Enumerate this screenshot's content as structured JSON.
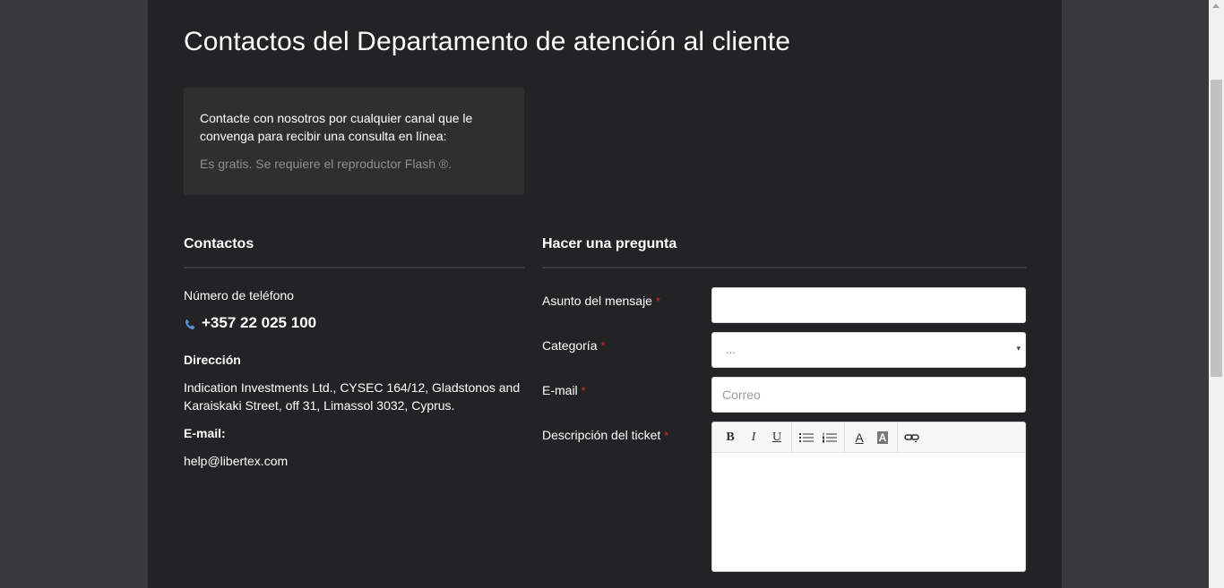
{
  "header": {
    "title": "Contactos del Departamento de atención al cliente"
  },
  "info_box": {
    "text": "Contacte con nosotros por cualquier canal que le convenga para recibir una consulta en línea:",
    "note": "Es gratis. Se requiere el reproductor Flash ®."
  },
  "contacts": {
    "title": "Contactos",
    "phone_label": "Número de teléfono",
    "phone": "+357 22 025 100",
    "address_label": "Dirección",
    "address": "Indication Investments Ltd., CYSEC 164/12, Gladstonos and Karaiskaki Street, off 31, Limassol 3032, Cyprus.",
    "email_label": "E-mail:",
    "email": "help@libertex.com"
  },
  "form": {
    "title": "Hacer una pregunta",
    "required_mark": "*",
    "subject_label": "Asunto del mensaje",
    "subject_value": "",
    "category_label": "Categoría",
    "category_value": "...",
    "category_arrow": "▾",
    "email_label": "E-mail",
    "email_placeholder": "Correo",
    "description_label": "Descripción del ticket",
    "toolbar": {
      "bold": "B",
      "italic": "I",
      "underline": "U",
      "font_color": "A",
      "bg_color": "A"
    }
  },
  "colors": {
    "page_bg": "#232325",
    "outer_bg": "#3a3a3c",
    "required": "#d9262b",
    "phone_icon": "#5b8ed6"
  }
}
